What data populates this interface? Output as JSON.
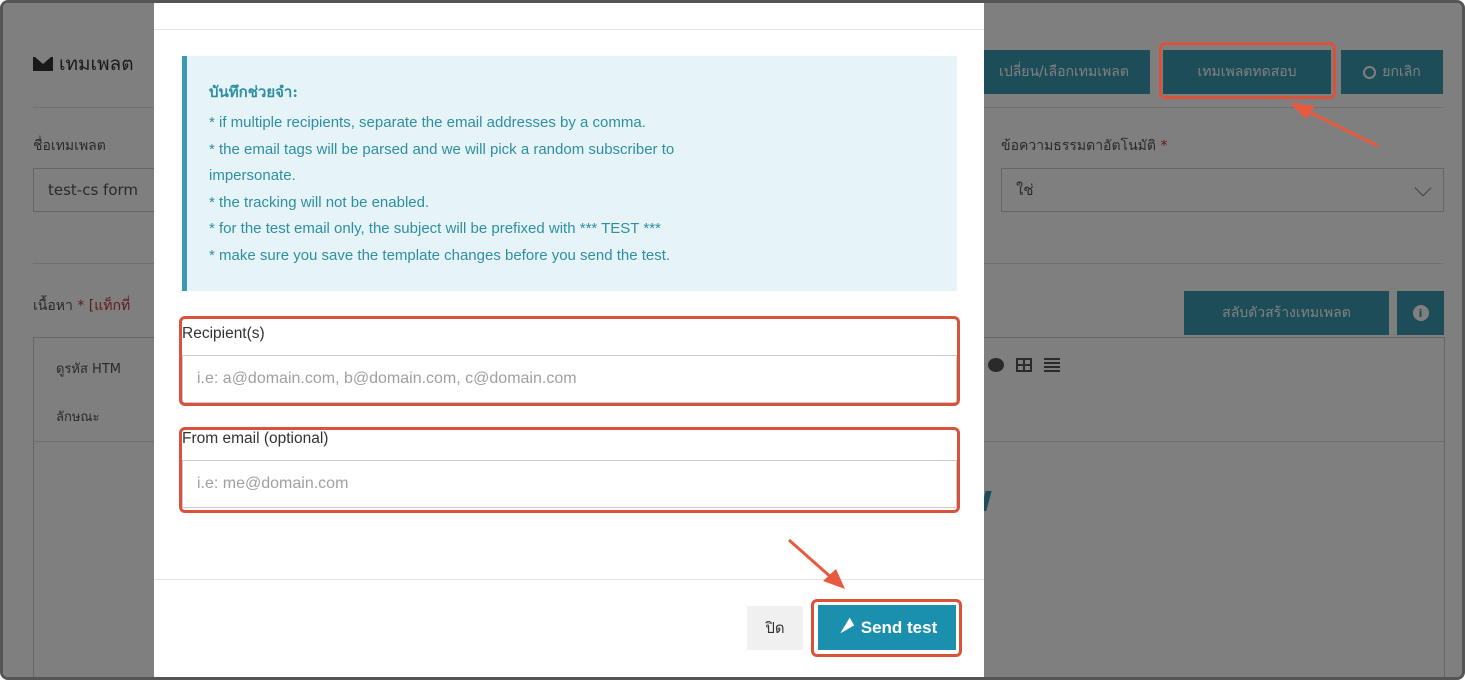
{
  "background": {
    "title": "เทมเพลต",
    "buttons": {
      "switch_template": "เปลี่ยน/เลือกเทมเพลต",
      "test_template": "เทมเพลตทดสอบ",
      "cancel": "ยกเลิก"
    },
    "template_name_label": "ชื่อเทมเพลต",
    "template_name_value": "test-cs form",
    "auto_plain_text_label": "ข้อความธรรมดาอัตโนมัติ",
    "auto_plain_text_required": "*",
    "auto_plain_text_value": "ใช่",
    "content_label": "เนื้อหา",
    "content_required": "* [แท็กที่",
    "switch_builder_button": "สลับตัวสร้างเทมเพลต",
    "info_button": "i",
    "toolbar_view_html": "ดูรหัส HTM",
    "toolbar_style": "ลักษณะ"
  },
  "modal": {
    "note_title": "บันทึกช่วยจำ:",
    "note_lines": [
      "* if multiple recipients, separate the email addresses by a comma.",
      "* the email tags will be parsed and we will pick a random subscriber to",
      "impersonate.",
      "* the tracking will not be enabled.",
      "* for the test email only, the subject will be prefixed with *** TEST ***",
      "* make sure you save the template changes before you send the test."
    ],
    "recipients_label": "Recipient(s)",
    "recipients_placeholder": "i.e: a@domain.com, b@domain.com, c@domain.com",
    "from_label": "From email (optional)",
    "from_placeholder": "i.e: me@domain.com",
    "close_button": "ปิด",
    "send_button": "Send test"
  },
  "colors": {
    "accent": "#3a9bb0",
    "send_button": "#1a8fae",
    "highlight": "#d9533c",
    "note_bg": "#e6f4f7"
  }
}
